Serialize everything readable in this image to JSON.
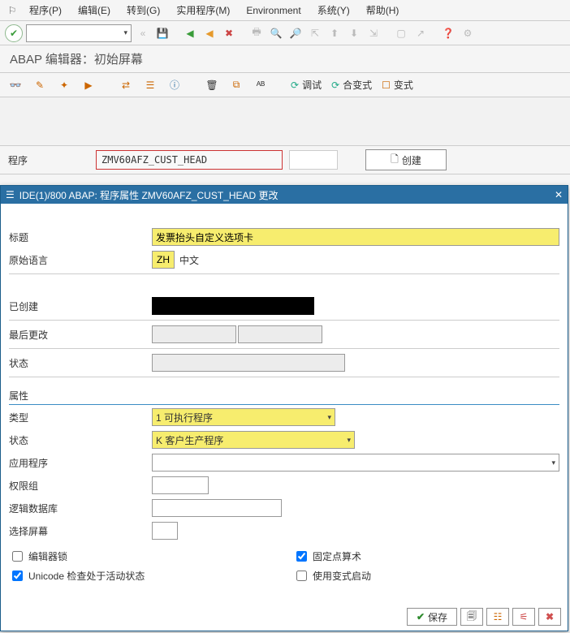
{
  "menu": {
    "program": "程序(P)",
    "edit": "编辑(E)",
    "goto": "转到(G)",
    "util": "实用程序(M)",
    "env": "Environment",
    "system": "系统(Y)",
    "help": "帮助(H)"
  },
  "subtitle": "ABAP 编辑器：初始屏幕",
  "tb2": {
    "debug": "调试",
    "combine": "合变式",
    "variant": "变式"
  },
  "progrow": {
    "label": "程序",
    "value": "ZMV60AFZ_CUST_HEAD",
    "create": "创建"
  },
  "dialog": {
    "title": "IDE(1)/800 ABAP: 程序属性 ZMV60AFZ_CUST_HEAD 更改",
    "titlelbl": "标题",
    "titleval": "发票抬头自定义选项卡",
    "langlbl": "原始语言",
    "langcode": "ZH",
    "langname": "中文",
    "createdlbl": "已创建",
    "lastchlbl": "最后更改",
    "statuslbl": "状态",
    "section": "属性",
    "typelbl": "类型",
    "typeval": "1 可执行程序",
    "statusproplbl": "状态",
    "statuspropval": "K 客户生产程序",
    "applbl": "应用程序",
    "authlbl": "权限组",
    "ldbllbl": "逻辑数据库",
    "selscrlbl": "选择屏幕",
    "chk_editor": "编辑器锁",
    "chk_fixed": "固定点算术",
    "chk_unicode": "Unicode 检查处于活动状态",
    "chk_variant": "使用变式启动",
    "save": "保存"
  }
}
